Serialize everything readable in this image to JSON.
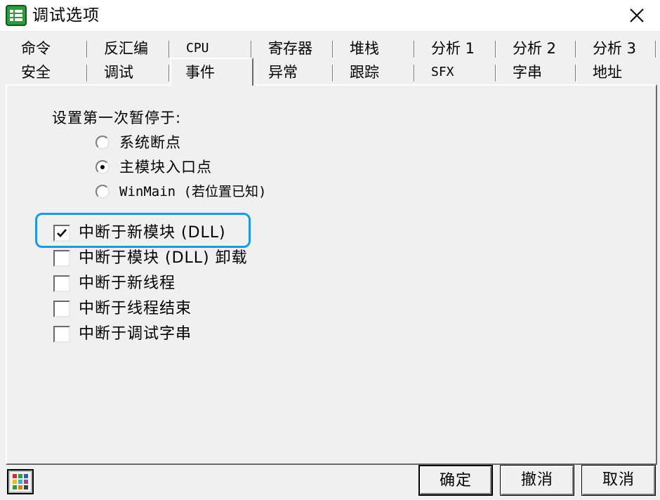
{
  "window": {
    "title": "调试选项"
  },
  "tabs_row1": [
    {
      "label": "命令"
    },
    {
      "label": "反汇编"
    },
    {
      "label": "CPU"
    },
    {
      "label": "寄存器"
    },
    {
      "label": "堆栈"
    },
    {
      "label": "分析 1"
    },
    {
      "label": "分析 2"
    },
    {
      "label": "分析 3"
    }
  ],
  "tabs_row2": [
    {
      "label": "安全"
    },
    {
      "label": "调试"
    },
    {
      "label": "事件",
      "selected": true
    },
    {
      "label": "异常"
    },
    {
      "label": "跟踪"
    },
    {
      "label": "SFX"
    },
    {
      "label": "字串"
    },
    {
      "label": "地址"
    }
  ],
  "events": {
    "first_pause_label": "设置第一次暂停于:",
    "radio_options": [
      {
        "label": "系统断点",
        "checked": false
      },
      {
        "label": "主模块入口点",
        "checked": true
      },
      {
        "label": "WinMain (若位置已知)",
        "checked": false
      }
    ],
    "checkboxes": [
      {
        "label": "中断于新模块 (DLL)",
        "checked": true
      },
      {
        "label": "中断于模块 (DLL) 卸载",
        "checked": false
      },
      {
        "label": "中断于新线程",
        "checked": false
      },
      {
        "label": "中断于线程结束",
        "checked": false
      },
      {
        "label": "中断于调试字串",
        "checked": false
      }
    ]
  },
  "buttons": {
    "ok": "确定",
    "cancel1": "撤消",
    "cancel2": "取消"
  },
  "colors": {
    "highlight": "#1a9ae0",
    "app_icon": "#2e9b3e",
    "panel": "#f0f0f0"
  },
  "icons": {
    "app": "ollydbg-app-icon",
    "close": "close-icon",
    "bottom": "palette-icon"
  }
}
